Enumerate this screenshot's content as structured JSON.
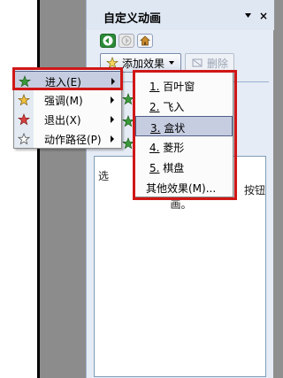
{
  "task_pane": {
    "title": "自定义动画",
    "close_glyph": "×",
    "nav": {
      "back_icon": "back-arrow-icon",
      "forward_icon": "forward-arrow-icon",
      "home_icon": "home-icon"
    },
    "add_effect_label": "添加效果",
    "remove_label": "删除",
    "hint_text_lines": [
      "选",
      "按钮",
      "画。"
    ]
  },
  "effect_menu": {
    "items": [
      {
        "label": "进入(E)",
        "icon": "star-green-icon",
        "has_submenu": true,
        "selected": true
      },
      {
        "label": "强调(M)",
        "icon": "star-yellow-icon",
        "has_submenu": true,
        "selected": false
      },
      {
        "label": "退出(X)",
        "icon": "star-red-icon",
        "has_submenu": true,
        "selected": false
      },
      {
        "label": "动作路径(P)",
        "icon": "star-outline-icon",
        "has_submenu": true,
        "selected": false
      }
    ]
  },
  "entrance_submenu": {
    "items": [
      {
        "number": "1.",
        "label": "百叶窗",
        "selected": false
      },
      {
        "number": "2.",
        "label": "飞入",
        "selected": false
      },
      {
        "number": "3.",
        "label": "盒状",
        "selected": true
      },
      {
        "number": "4.",
        "label": "菱形",
        "selected": false
      },
      {
        "number": "5.",
        "label": "棋盘",
        "selected": false
      },
      {
        "number": "",
        "label": "其他效果(M)...",
        "selected": false
      }
    ]
  },
  "colors": {
    "highlight_border": "#d01717",
    "selection_bg": "#c6cde0",
    "pane_bg": "#e6ecf5"
  }
}
